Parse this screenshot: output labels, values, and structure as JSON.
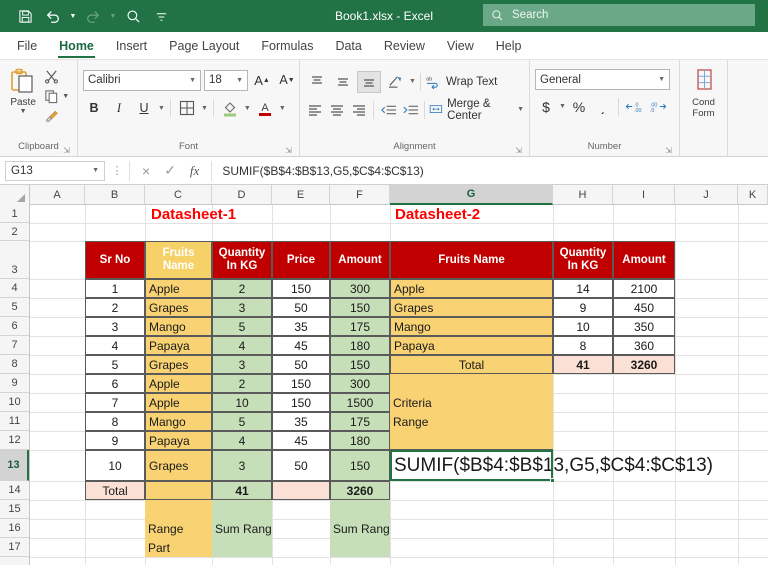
{
  "titlebar": {
    "document_title": "Book1.xlsx  -  Excel",
    "qat": [
      {
        "name": "save-icon",
        "label": "Save"
      },
      {
        "name": "undo-icon",
        "label": "Undo"
      },
      {
        "name": "redo-icon",
        "label": "Redo"
      },
      {
        "name": "search-zoom-icon",
        "label": "Search"
      },
      {
        "name": "customize-quick-access-toolbar-icon",
        "label": "Customize Quick Access Toolbar"
      }
    ],
    "search_placeholder": "Search"
  },
  "ribbon_tabs": [
    {
      "label": "File",
      "active": false
    },
    {
      "label": "Home",
      "active": true
    },
    {
      "label": "Insert",
      "active": false
    },
    {
      "label": "Page Layout",
      "active": false
    },
    {
      "label": "Formulas",
      "active": false
    },
    {
      "label": "Data",
      "active": false
    },
    {
      "label": "Review",
      "active": false
    },
    {
      "label": "View",
      "active": false
    },
    {
      "label": "Help",
      "active": false
    }
  ],
  "ribbon": {
    "clipboard": {
      "group_label": "Clipboard",
      "paste_label": "Paste",
      "cut_label": "Cut",
      "copy_label": "Copy",
      "format_painter_label": "Format Painter"
    },
    "font": {
      "group_label": "Font",
      "font_name": "Calibri",
      "font_size": "18",
      "grow_font_label": "A",
      "shrink_font_label": "A",
      "bold_label": "B",
      "italic_label": "I",
      "underline_label": "U",
      "borders_label": "Borders",
      "fill_color_label": "Fill Color",
      "font_color_label": "A"
    },
    "alignment": {
      "group_label": "Alignment",
      "wrap_text_label": "Wrap Text",
      "merge_center_label": "Merge & Center"
    },
    "number": {
      "group_label": "Number",
      "format_value": "General",
      "currency_label": "$",
      "percent_label": "%",
      "comma_label": "͵",
      "decrease_decimal_label": ".00",
      "increase_decimal_label": ".00"
    },
    "styles": {
      "conditional_formatting_line1": "Cond",
      "conditional_formatting_line2": "Form"
    }
  },
  "formula_bar": {
    "name_box": "G13",
    "cancel_label": "×",
    "enter_label": "✓",
    "function_label": "fx",
    "formula": "SUMIF($B$4:$B$13,G5,$C$4:$C$13)"
  },
  "grid": {
    "columns": [
      "A",
      "B",
      "C",
      "D",
      "E",
      "F",
      "G",
      "H",
      "I",
      "J",
      "K"
    ],
    "active_column": "G",
    "active_row": "13",
    "rows": [
      "1",
      "2",
      "3",
      "4",
      "5",
      "6",
      "7",
      "8",
      "9",
      "10",
      "11",
      "12",
      "13",
      "14",
      "15",
      "16",
      "17"
    ]
  },
  "datasheet1": {
    "title": "Datasheet-1",
    "headers": [
      "Sr No",
      "Fruits\nName",
      "Quantity\nIn KG",
      "Price",
      "Amount"
    ],
    "header_lines": [
      [
        "Sr No"
      ],
      [
        "Fruits",
        "Name"
      ],
      [
        "Quantity",
        "In KG"
      ],
      [
        "Price"
      ],
      [
        "Amount"
      ]
    ],
    "rows": [
      {
        "sr": "1",
        "fruit": "Apple",
        "qty": "2",
        "price": "150",
        "amount": "300"
      },
      {
        "sr": "2",
        "fruit": "Grapes",
        "qty": "3",
        "price": "50",
        "amount": "150"
      },
      {
        "sr": "3",
        "fruit": "Mango",
        "qty": "5",
        "price": "35",
        "amount": "175"
      },
      {
        "sr": "4",
        "fruit": "Papaya",
        "qty": "4",
        "price": "45",
        "amount": "180"
      },
      {
        "sr": "5",
        "fruit": "Grapes",
        "qty": "3",
        "price": "50",
        "amount": "150"
      },
      {
        "sr": "6",
        "fruit": "Apple",
        "qty": "2",
        "price": "150",
        "amount": "300"
      },
      {
        "sr": "7",
        "fruit": "Apple",
        "qty": "10",
        "price": "150",
        "amount": "1500"
      },
      {
        "sr": "8",
        "fruit": "Mango",
        "qty": "5",
        "price": "35",
        "amount": "175"
      },
      {
        "sr": "9",
        "fruit": "Papaya",
        "qty": "4",
        "price": "45",
        "amount": "180"
      },
      {
        "sr": "10",
        "fruit": "Grapes",
        "qty": "3",
        "price": "50",
        "amount": "150"
      }
    ],
    "total": {
      "label": "Total",
      "qty": "41",
      "amount": "3260"
    },
    "annotations": {
      "range_part_line1": "Range",
      "range_part_line2": "Part",
      "sum_range_c": "Sum Range",
      "sum_range_e": "Sum Range"
    }
  },
  "datasheet2": {
    "title": "Datasheet-2",
    "header_lines": [
      [
        "Fruits Name"
      ],
      [
        "Quantity",
        "In KG"
      ],
      [
        "Amount"
      ]
    ],
    "rows": [
      {
        "fruit": "Apple",
        "qty": "14",
        "amount": "2100"
      },
      {
        "fruit": "Grapes",
        "qty": "9",
        "amount": "450"
      },
      {
        "fruit": "Mango",
        "qty": "10",
        "amount": "350"
      },
      {
        "fruit": "Papaya",
        "qty": "8",
        "amount": "360"
      }
    ],
    "total": {
      "label": "Total",
      "qty": "41",
      "amount": "3260"
    },
    "labels": {
      "criteria": "Criteria",
      "range": "Range"
    }
  },
  "active_cell_formula": {
    "parts": [
      {
        "text": "SUMIF(",
        "color": "black"
      },
      {
        "text": "$B$4:$B$13",
        "color": "red"
      },
      {
        "text": ",",
        "color": "black"
      },
      {
        "text": "G5",
        "color": "green"
      },
      {
        "text": ",",
        "color": "black"
      },
      {
        "text": "$C$4:$C$13",
        "color": "red"
      },
      {
        "text": ")",
        "color": "black"
      }
    ],
    "full_text": "SUMIF($B$4:$B$13,G5,$C$4:$C$13)"
  },
  "colors": {
    "excel_green": "#217346",
    "header_red": "#C00000",
    "header_gold": "#F5D168",
    "fill_gold": "#F9D373",
    "fill_green": "#C6DFB9",
    "fill_pink": "#FBE0D5",
    "title_red": "#FF0000",
    "formula_red": "#CC0000",
    "formula_green": "#1B8A3A"
  }
}
